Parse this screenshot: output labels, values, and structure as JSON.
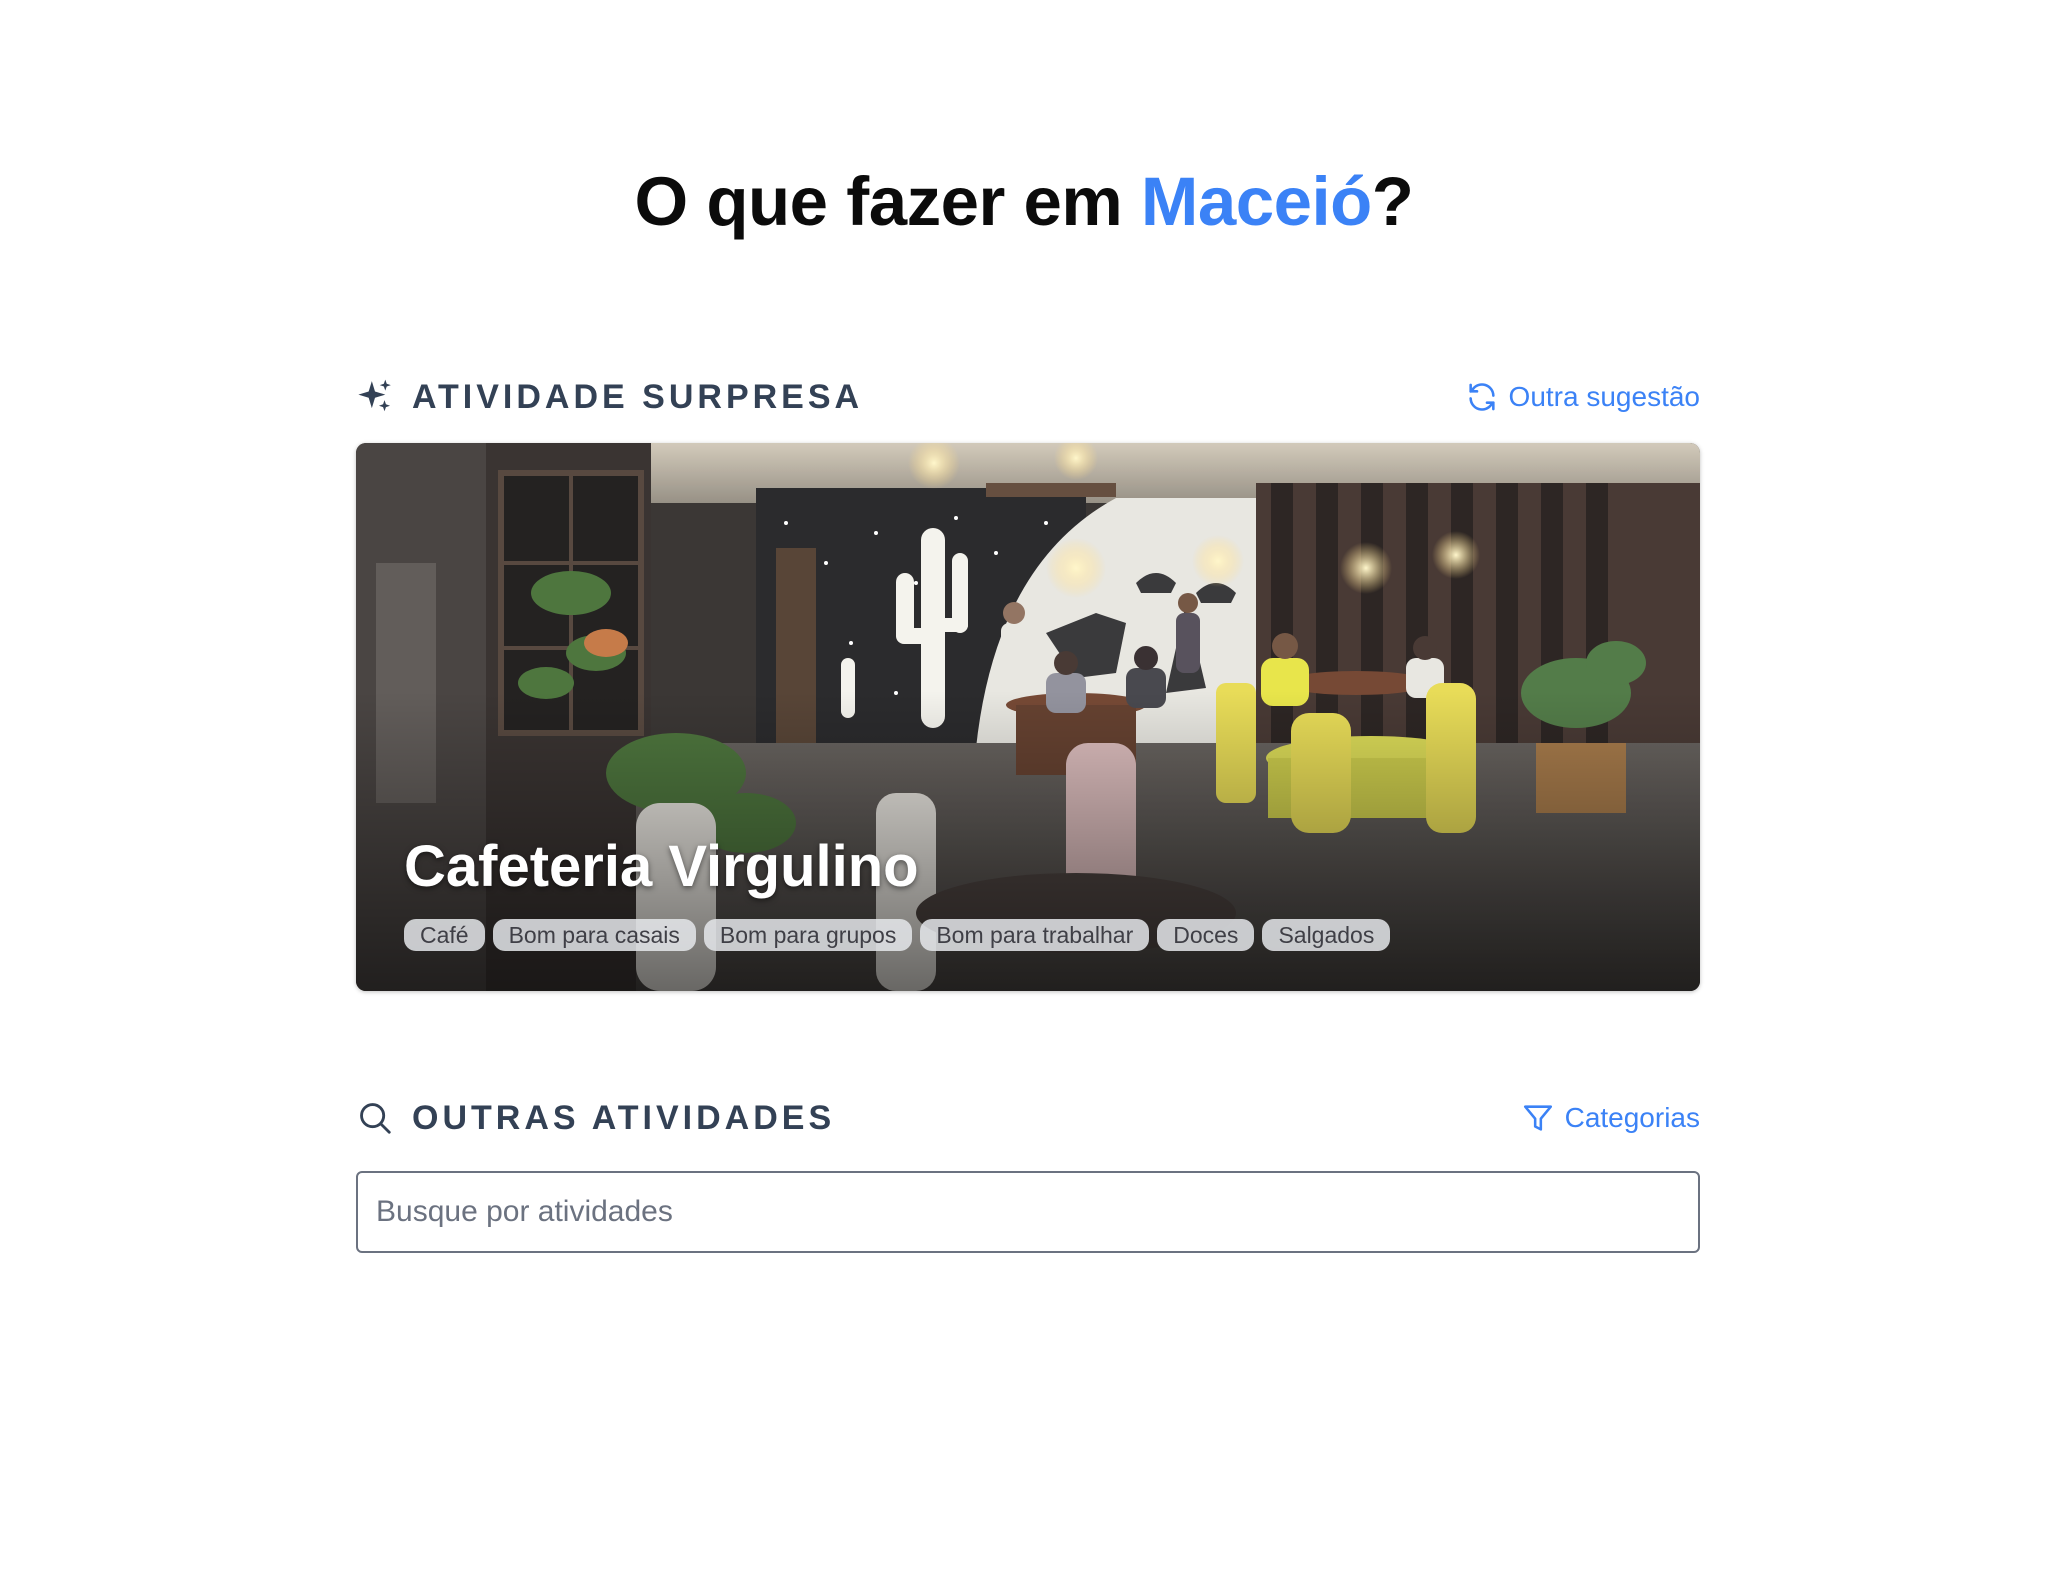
{
  "page": {
    "title_prefix": "O que fazer em ",
    "title_city": "Maceió",
    "title_suffix": "?"
  },
  "surprise": {
    "heading": "ATIVIDADE SURPRESA",
    "heading_icon": "sparkles-icon",
    "refresh_label": "Outra sugestão",
    "refresh_icon": "refresh-icon",
    "place_name": "Cafeteria Virgulino",
    "tags": [
      "Café",
      "Bom para casais",
      "Bom para grupos",
      "Bom para trabalhar",
      "Doces",
      "Salgados"
    ]
  },
  "others": {
    "heading": "OUTRAS ATIVIDADES",
    "heading_icon": "search-icon",
    "filter_label": "Categorias",
    "filter_icon": "filter-icon",
    "search_placeholder": "Busque por atividades",
    "search_value": ""
  },
  "colors": {
    "accent": "#3b82f6",
    "heading": "#334155",
    "title": "#0b0b0b"
  }
}
